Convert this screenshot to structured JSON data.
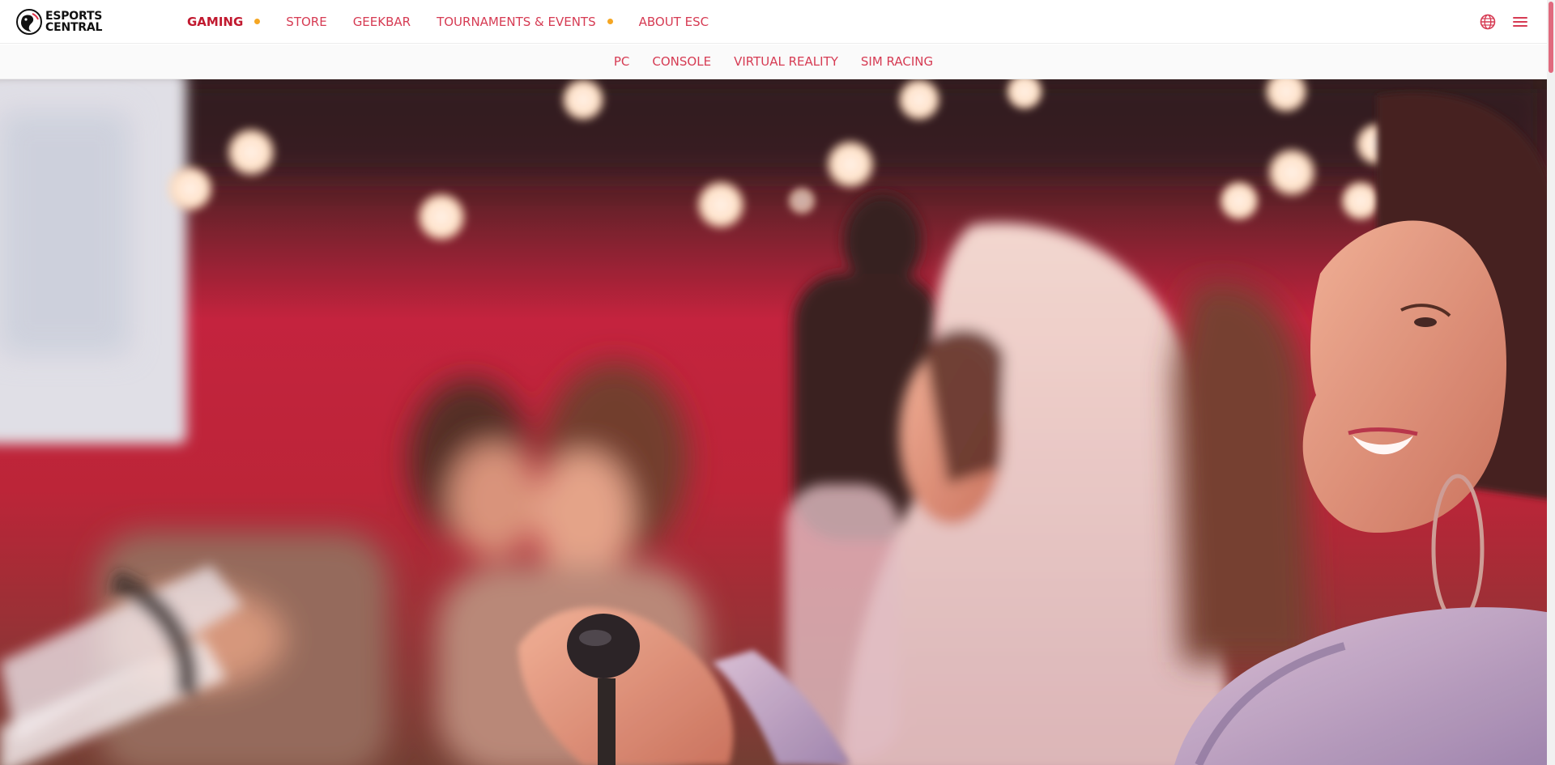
{
  "brand": {
    "name_line1": "ESPORTS",
    "name_line2": "CENTRAL",
    "icon": "esports-central-logo"
  },
  "main_nav": {
    "items": [
      {
        "label": "GAMING",
        "active": true,
        "has_dot": true
      },
      {
        "label": "STORE",
        "active": false,
        "has_dot": false
      },
      {
        "label": "GEEKBAR",
        "active": false,
        "has_dot": false
      },
      {
        "label": "TOURNAMENTS & EVENTS",
        "active": false,
        "has_dot": true
      },
      {
        "label": "ABOUT ESC",
        "active": false,
        "has_dot": false
      }
    ]
  },
  "header_tools": {
    "language_icon": "globe-icon",
    "menu_icon": "hamburger-menu-icon"
  },
  "sub_nav": {
    "items": [
      {
        "label": "PC"
      },
      {
        "label": "CONSOLE"
      },
      {
        "label": "VIRTUAL REALITY"
      },
      {
        "label": "SIM RACING"
      }
    ]
  },
  "colors": {
    "accent": "#d63b53",
    "accent_active": "#c1192f",
    "dot": "#f5a623",
    "hero_wall": "#b8203a"
  }
}
